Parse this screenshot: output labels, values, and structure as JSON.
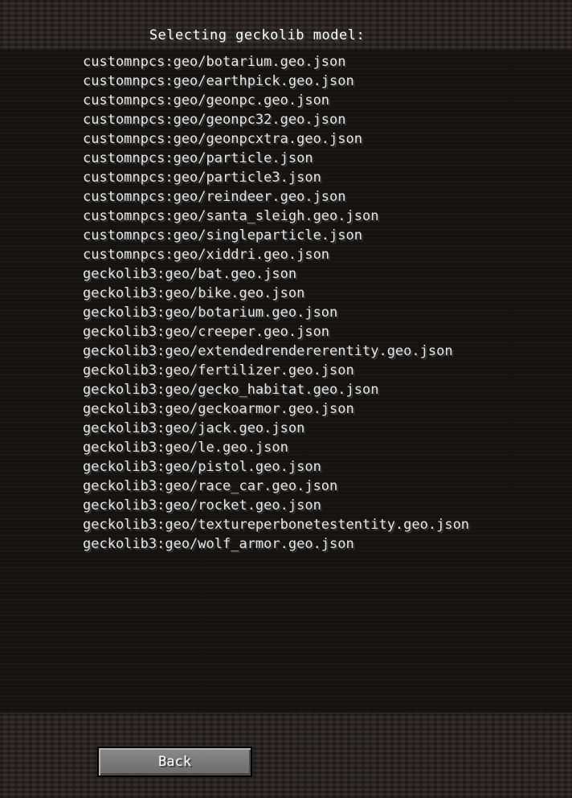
{
  "header": {
    "title": "Selecting geckolib model:"
  },
  "models": [
    "customnpcs:geo/botarium.geo.json",
    "customnpcs:geo/earthpick.geo.json",
    "customnpcs:geo/geonpc.geo.json",
    "customnpcs:geo/geonpc32.geo.json",
    "customnpcs:geo/geonpcxtra.geo.json",
    "customnpcs:geo/particle.json",
    "customnpcs:geo/particle3.json",
    "customnpcs:geo/reindeer.geo.json",
    "customnpcs:geo/santa_sleigh.geo.json",
    "customnpcs:geo/singleparticle.json",
    "customnpcs:geo/xiddri.geo.json",
    "geckolib3:geo/bat.geo.json",
    "geckolib3:geo/bike.geo.json",
    "geckolib3:geo/botarium.geo.json",
    "geckolib3:geo/creeper.geo.json",
    "geckolib3:geo/extendedrendererentity.geo.json",
    "geckolib3:geo/fertilizer.geo.json",
    "geckolib3:geo/gecko_habitat.geo.json",
    "geckolib3:geo/geckoarmor.geo.json",
    "geckolib3:geo/jack.geo.json",
    "geckolib3:geo/le.geo.json",
    "geckolib3:geo/pistol.geo.json",
    "geckolib3:geo/race_car.geo.json",
    "geckolib3:geo/rocket.geo.json",
    "geckolib3:geo/textureperbonetestentity.geo.json",
    "geckolib3:geo/wolf_armor.geo.json"
  ],
  "footer": {
    "back_label": "Back"
  }
}
